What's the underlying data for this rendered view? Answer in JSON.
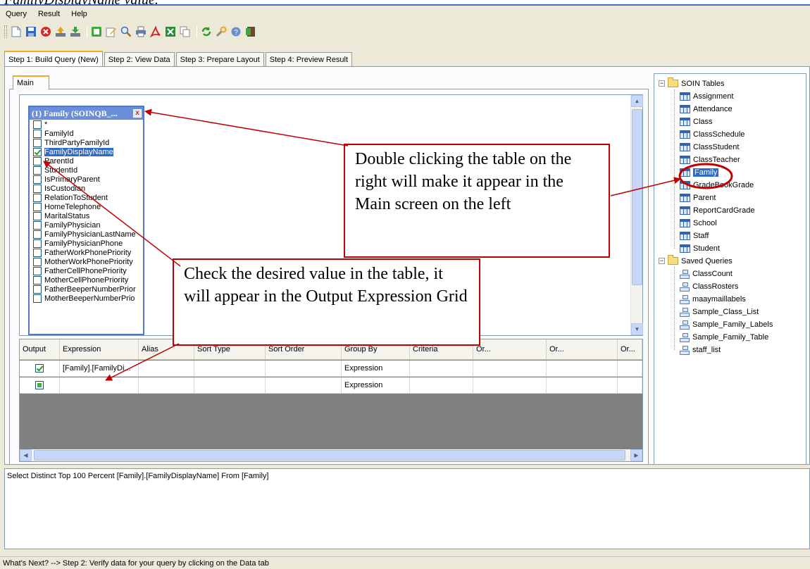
{
  "doc_caption": "FamilyDisplayName value.",
  "menu": [
    "Query",
    "Result",
    "Help"
  ],
  "toolbar": {
    "buttons": [
      "new-icon",
      "save-icon",
      "delete-icon",
      "upload-icon",
      "download-icon",
      "run-icon",
      "edit-icon",
      "search-icon",
      "print-icon",
      "pdf-icon",
      "export-icon",
      "copy-icon",
      "refresh-icon",
      "settings-icon",
      "help-icon",
      "exit-icon"
    ]
  },
  "step_tabs": [
    {
      "label": "Step 1: Build Query (New)",
      "active": true
    },
    {
      "label": "Step 2: View Data",
      "active": false
    },
    {
      "label": "Step 3: Prepare Layout",
      "active": false
    },
    {
      "label": "Step 4: Preview Result",
      "active": false
    }
  ],
  "main_tab": "Main",
  "table_box": {
    "title": "(1) Family (SOINQB_...",
    "close": "x",
    "fields": [
      {
        "name": "*",
        "checked": false
      },
      {
        "name": "FamilyId",
        "checked": false
      },
      {
        "name": "ThirdPartyFamilyId",
        "checked": false
      },
      {
        "name": "FamilyDisplayName",
        "checked": true
      },
      {
        "name": "ParentId",
        "checked": false
      },
      {
        "name": "StudentId",
        "checked": false
      },
      {
        "name": "IsPrimaryParent",
        "checked": false
      },
      {
        "name": "IsCustodian",
        "checked": false
      },
      {
        "name": "RelationToStudent",
        "checked": false
      },
      {
        "name": "HomeTelephone",
        "checked": false
      },
      {
        "name": "MaritalStatus",
        "checked": false
      },
      {
        "name": "FamilyPhysician",
        "checked": false
      },
      {
        "name": "FamilyPhysicianLastName",
        "checked": false
      },
      {
        "name": "FamilyPhysicianPhone",
        "checked": false
      },
      {
        "name": "FatherWorkPhonePriority",
        "checked": false
      },
      {
        "name": "MotherWorkPhonePriority",
        "checked": false
      },
      {
        "name": "FatherCellPhonePriority",
        "checked": false
      },
      {
        "name": "MotherCellPhonePriority",
        "checked": false
      },
      {
        "name": "FatherBeeperNumberPrior",
        "checked": false
      },
      {
        "name": "MotherBeeperNumberPrio",
        "checked": false
      }
    ]
  },
  "grid": {
    "headers": [
      "Output",
      "Expression",
      "Alias",
      "Sort Type",
      "Sort Order",
      "Group By",
      "Criteria",
      "Or...",
      "Or...",
      "Or..."
    ],
    "rows": [
      {
        "output": "check",
        "expression": "[Family].[FamilyDi...",
        "group_by": "Expression"
      },
      {
        "output": "square",
        "expression": "",
        "group_by": "Expression"
      }
    ]
  },
  "tree": {
    "groups": [
      {
        "label": "SOIN Tables",
        "items": [
          "Assignment",
          "Attendance",
          "Class",
          "ClassSchedule",
          "ClassStudent",
          "ClassTeacher",
          "Family",
          "GradeBookGrade",
          "Parent",
          "ReportCardGrade",
          "School",
          "Staff",
          "Student"
        ]
      },
      {
        "label": "Saved Queries",
        "items": [
          "ClassCount",
          "ClassRosters",
          "maaymaillabels",
          "Sample_Class_List",
          "Sample_Family_Labels",
          "Sample_Family_Table",
          "staff_list"
        ]
      }
    ],
    "selected": "Family"
  },
  "sql": "Select Distinct Top 100 Percent [Family].[FamilyDisplayName] From [Family]",
  "status": "What's Next? --> Step 2: Verify data for your query by clicking on the Data tab",
  "callouts": {
    "top": "Double clicking the table on the right will make it appear in the Main screen on the left",
    "bottom": "Check the desired value in the table, it will appear in the Output Expression Grid"
  },
  "colors": {
    "annotation": "#c00000",
    "accent": "#f5a623",
    "selection": "#316ac5"
  }
}
